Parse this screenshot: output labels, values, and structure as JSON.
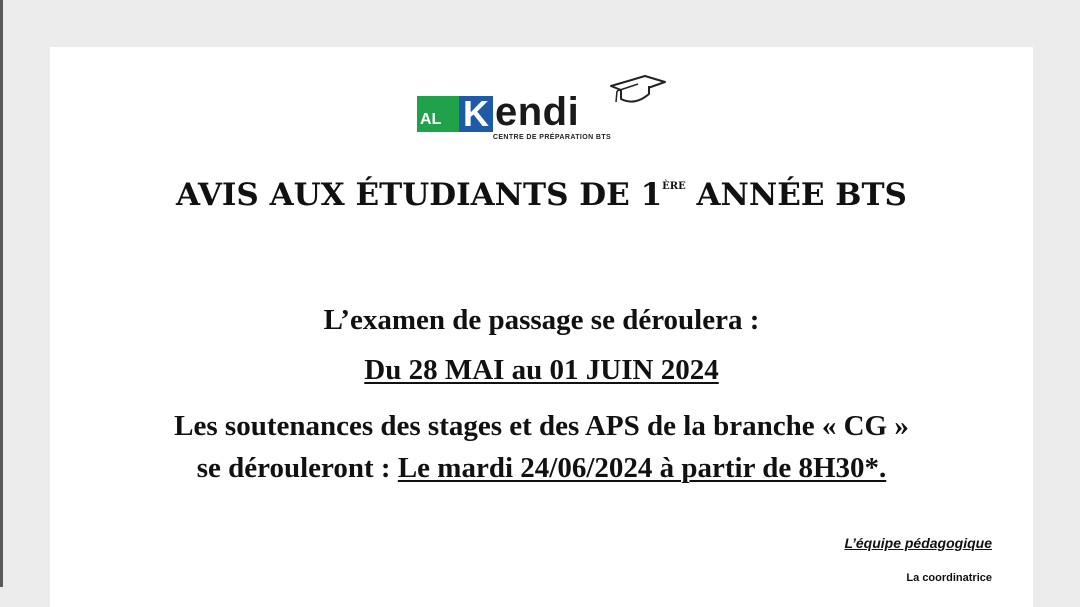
{
  "logo": {
    "prefix": "AL",
    "letter": "K",
    "word": "endi",
    "subtitle": "CENTRE DE PRÉPARATION BTS",
    "icon": "graduation-cap-icon",
    "colors": {
      "green": "#1fa24a",
      "blue": "#1e5aa8"
    }
  },
  "heading": {
    "before": "AVIS AUX ÉTUDIANTS DE 1",
    "superscript": "ÈRE",
    "after": " ANNÉE BTS"
  },
  "body": {
    "line1": "L’examen de passage se déroulera :",
    "line2": "Du 28 MAI au 01 JUIN 2024",
    "line3": "Les soutenances des stages et des APS de la branche « CG »",
    "line4_plain": "se dérouleront : ",
    "line4_underlined": "Le mardi 24/06/2024 à partir de 8H30*."
  },
  "signature": {
    "team": "L’équipe pédagogique",
    "role": "La coordinatrice"
  }
}
